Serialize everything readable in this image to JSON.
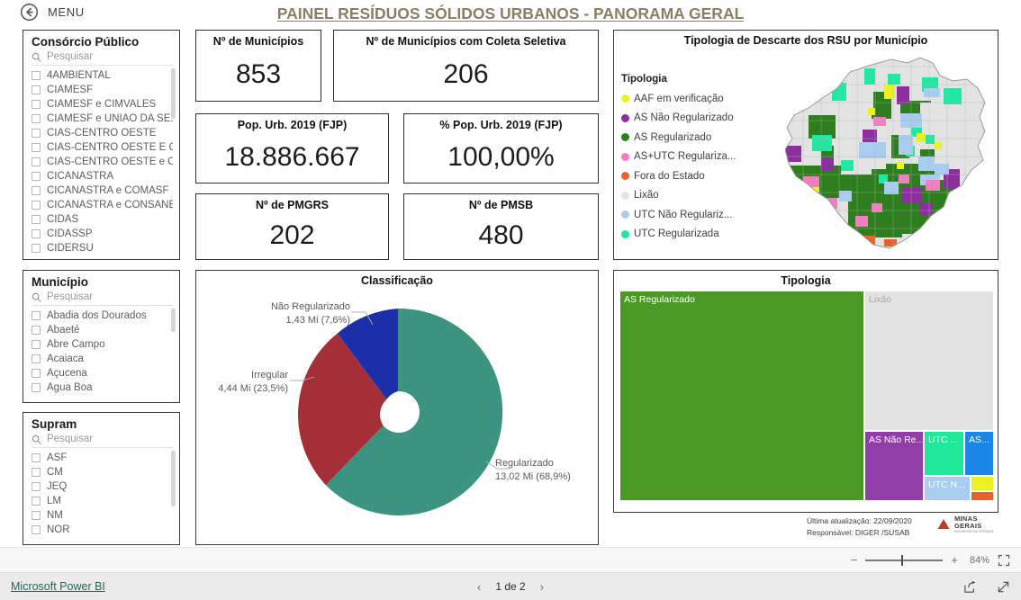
{
  "topbar": {
    "menu_label": "MENU",
    "back_icon": "back-arrow-circle-icon"
  },
  "report_title": "PAINEL RESÍDUOS SÓLIDOS URBANOS - PANORAMA GERAL",
  "slicers": [
    {
      "title": "Consórcio Público",
      "search_placeholder": "Pesquisar",
      "items": [
        "4AMBIENTAL",
        "CIAMESF",
        "CIAMESF e CIMVALES",
        "CIAMESF e UNIÃO DA SE...",
        "CIAS-CENTRO OESTE",
        "CIAS-CENTRO OESTE E CI...",
        "CIAS-CENTRO OESTE e C...",
        "CICANASTRA",
        "CICANASTRA e COMASF",
        "CICANASTRA e CONSANE",
        "CIDAS",
        "CIDASSP",
        "CIDERSU"
      ]
    },
    {
      "title": "Município",
      "search_placeholder": "Pesquisar",
      "items": [
        "Abadia dos Dourados",
        "Abaeté",
        "Abre Campo",
        "Acaiaca",
        "Açucena",
        "Água Boa"
      ]
    },
    {
      "title": "Supram",
      "search_placeholder": "Pesquisar",
      "items": [
        "ASF",
        "CM",
        "JEQ",
        "LM",
        "NM",
        "NOR"
      ]
    }
  ],
  "kpis": [
    {
      "title": "Nº de Municípios",
      "value": "853"
    },
    {
      "title": "Nº de Municípios com Coleta Seletiva",
      "value": "206"
    },
    {
      "title": "Pop. Urb. 2019 (FJP)",
      "value": "18.886.667"
    },
    {
      "title": "% Pop. Urb. 2019 (FJP)",
      "value": "100,00%"
    },
    {
      "title": "Nº de PMGRS",
      "value": "202"
    },
    {
      "title": "Nº de PMSB",
      "value": "480"
    }
  ],
  "map_panel": {
    "title": "Tipologia de Descarte dos RSU por Município",
    "legend_title": "Tipologia",
    "legend": [
      {
        "label": "AAF em verificação",
        "color": "#eaf224"
      },
      {
        "label": "AS Não Regularizado",
        "color": "#8e2fa0"
      },
      {
        "label": "AS Regularizado",
        "color": "#2e7d1e"
      },
      {
        "label": "AS+UTC Regulariza...",
        "color": "#f07fc0"
      },
      {
        "label": "Fora do Estado",
        "color": "#e8622a"
      },
      {
        "label": "Lixão",
        "color": "#e3e3e3"
      },
      {
        "label": "UTC Não Regulariz...",
        "color": "#a8cdf0"
      },
      {
        "label": "UTC Regularizada",
        "color": "#20e8a0"
      }
    ]
  },
  "chart_data": [
    {
      "type": "pie",
      "title": "Classificação",
      "categories": [
        "Regularizado",
        "Irregular",
        "Não Regularizado"
      ],
      "values": [
        68.9,
        23.5,
        7.6
      ],
      "labels": [
        "Regularizado\n13,02 Mi (68,9%)",
        "Irregular\n4,44 Mi (23,5%)",
        "Não Regularizado\n1,43 Mi (7,6%)"
      ],
      "slices": [
        {
          "name": "Regularizado",
          "amount": "13,02 Mi",
          "percent": "68,9%",
          "value": 68.9,
          "color": "#3d9382"
        },
        {
          "name": "Irregular",
          "amount": "4,44 Mi",
          "percent": "23,5%",
          "value": 23.5,
          "color": "#a52f38"
        },
        {
          "name": "Não Regularizado",
          "amount": "1,43 Mi",
          "percent": "7,6%",
          "value": 7.6,
          "color": "#1a2fa8"
        }
      ],
      "legend": "none",
      "donut": true
    },
    {
      "type": "treemap",
      "title": "Tipologia",
      "tiles": [
        {
          "label": "AS Regularizado",
          "color": "#4a9925",
          "value": 52.0
        },
        {
          "label": "Lixão",
          "color": "#e3e3e3",
          "value": 26.0
        },
        {
          "label": "AS Não Re...",
          "color": "#913da8",
          "value": 7.0
        },
        {
          "label": "UTC ...",
          "color": "#1fe89a",
          "value": 4.2
        },
        {
          "label": "AS...",
          "color": "#1a86e8",
          "value": 3.4
        },
        {
          "label": "UTC N...",
          "color": "#a8cdf0",
          "value": 3.2
        },
        {
          "label": "",
          "color": "#eaf224",
          "value": 1.6
        },
        {
          "label": "",
          "color": "#e8622a",
          "value": 0.9
        }
      ]
    }
  ],
  "footer": {
    "update_line": "Última atualização: 22/09/2020",
    "owner_line": "Responsável: DIGER /SUSAB",
    "logo_line1": "MINAS",
    "logo_line2": "GERAIS",
    "logo_sub": "GOVERNO DO ESTADO"
  },
  "statusbar": {
    "zoom_minus": "−",
    "zoom_plus": "+",
    "zoom_level": "84%",
    "fit_icon": "fit-to-screen-icon",
    "brand": "Microsoft Power BI",
    "prev_arrow": "‹",
    "next_arrow": "›",
    "page_label": "1 de 2",
    "share_icon": "share-icon",
    "fullscreen_icon": "fullscreen-icon"
  }
}
